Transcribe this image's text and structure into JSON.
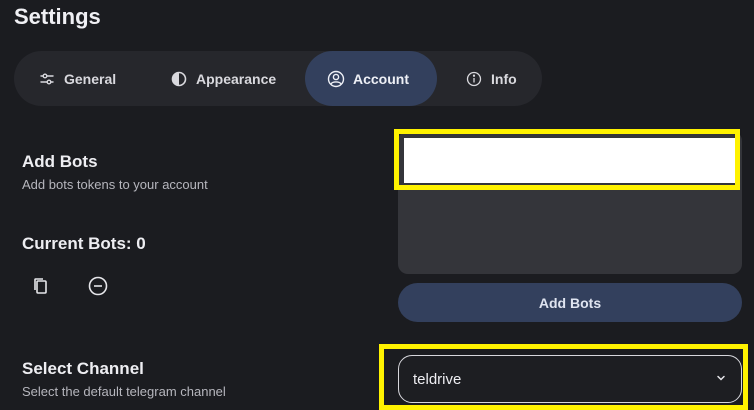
{
  "page": {
    "title": "Settings"
  },
  "tabs": [
    {
      "label": "General",
      "icon": "sliders-icon",
      "active": false
    },
    {
      "label": "Appearance",
      "icon": "contrast-icon",
      "active": false
    },
    {
      "label": "Account",
      "icon": "user-circle-icon",
      "active": true
    },
    {
      "label": "Info",
      "icon": "info-icon",
      "active": false
    }
  ],
  "add_bots": {
    "title": "Add Bots",
    "subtitle": "Add bots tokens to your account",
    "input_value": "",
    "button_label": "Add Bots"
  },
  "current_bots": {
    "title": "Current Bots: 0",
    "icons": [
      "copy-icon",
      "remove-circle-icon"
    ]
  },
  "channel": {
    "title": "Select Channel",
    "subtitle": "Select the default telegram channel",
    "selected": "teldrive"
  },
  "colors": {
    "background": "#1b1c20",
    "tab_bar": "#26272c",
    "accent": "#33405d",
    "highlight": "#fff200"
  }
}
